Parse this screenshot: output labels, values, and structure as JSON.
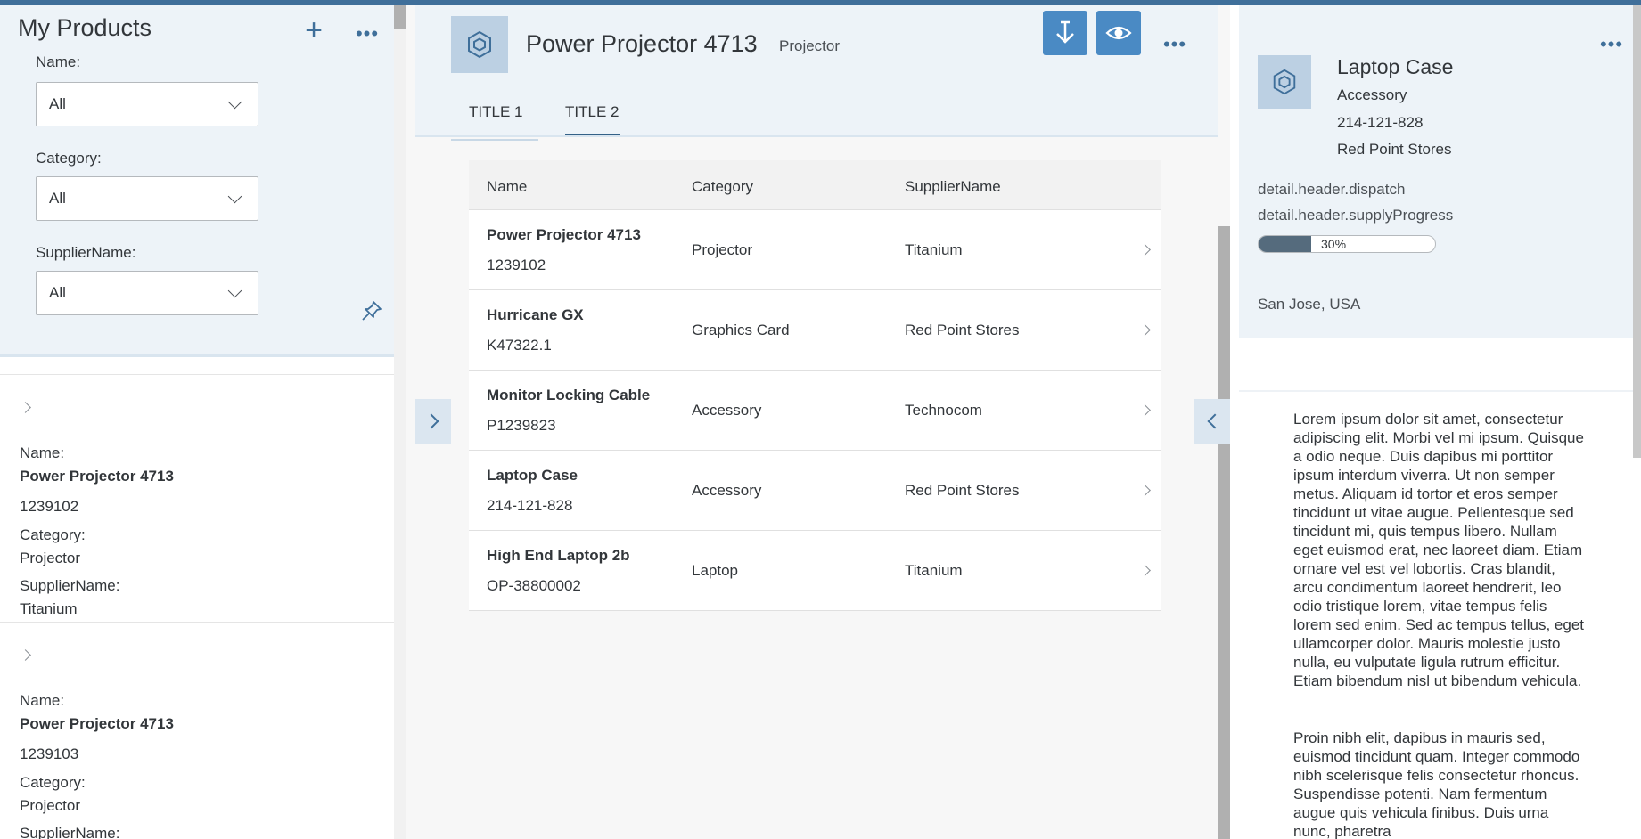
{
  "master": {
    "title": "My Products",
    "filters": [
      {
        "label": "Name:",
        "value": "All"
      },
      {
        "label": "Category:",
        "value": "All"
      },
      {
        "label": "SupplierName:",
        "value": "All"
      }
    ],
    "cards": [
      {
        "name_label": "Name:",
        "name": "Power Projector 4713",
        "id": "1239102",
        "category_label": "Category:",
        "category": "Projector",
        "supplier_label": "SupplierName:",
        "supplier": "Titanium"
      },
      {
        "name_label": "Name:",
        "name": "Power Projector 4713",
        "id": "1239103",
        "category_label": "Category:",
        "category": "Projector",
        "supplier_label": "SupplierName:"
      }
    ]
  },
  "detail": {
    "title": "Power Projector 4713",
    "subtitle": "Projector",
    "tabs": [
      {
        "label": "TITLE 1"
      },
      {
        "label": "TITLE 2"
      }
    ],
    "active_tab": "TITLE 2",
    "table": {
      "columns": [
        "Name",
        "Category",
        "SupplierName"
      ],
      "rows": [
        {
          "name": "Power Projector 4713",
          "id": "1239102",
          "category": "Projector",
          "supplier": "Titanium"
        },
        {
          "name": "Hurricane GX",
          "id": "K47322.1",
          "category": "Graphics Card",
          "supplier": "Red Point Stores"
        },
        {
          "name": "Monitor Locking Cable",
          "id": "P1239823",
          "category": "Accessory",
          "supplier": "Technocom"
        },
        {
          "name": "Laptop Case",
          "id": "214-121-828",
          "category": "Accessory",
          "supplier": "Red Point Stores"
        },
        {
          "name": "High End Laptop 2b",
          "id": "OP-38800002",
          "category": "Laptop",
          "supplier": "Titanium"
        }
      ]
    }
  },
  "side": {
    "title": "Laptop Case",
    "category": "Accessory",
    "id": "214-121-828",
    "supplier": "Red Point Stores",
    "dispatch_label": "detail.header.dispatch",
    "supply_label": "detail.header.supplyProgress",
    "progress_percent": 30,
    "progress_text": "30%",
    "location": "San Jose, USA",
    "paragraph_1": "Lorem ipsum dolor sit amet, consectetur adipiscing elit. Morbi vel mi ipsum. Quisque a odio neque. Duis dapibus mi porttitor ipsum interdum viverra. Ut non semper metus. Aliquam id tortor et eros semper tincidunt ut vitae augue. Pellentesque sed tincidunt mi, quis tempus libero. Nullam eget euismod erat, nec laoreet diam. Etiam ornare vel est vel lobortis. Cras blandit, arcu condimentum laoreet hendrerit, leo odio tristique lorem, vitae tempus felis lorem sed enim. Sed ac tempus tellus, eget ullamcorper dolor. Mauris molestie justo nulla, eu vulputate ligula rutrum efficitur. Etiam bibendum nisl ut bibendum vehicula.",
    "paragraph_2": "Proin nibh elit, dapibus in mauris sed, euismod tincidunt quam. Integer commodo nibh scelerisque felis consectetur rhoncus. Suspendisse potenti. Nam fermentum augue quis vehicula finibus. Duis urna nunc, pharetra"
  },
  "icons": {
    "add": "plus-icon",
    "more": "overflow-dots-icon",
    "pin": "pin-icon",
    "product": "product-cube-icon",
    "download": "download-icon",
    "view": "eye-icon",
    "expand": "chevron-right-icon",
    "collapse": "chevron-left-icon"
  },
  "colors": {
    "accent": "#3f6f9a",
    "button": "#4a8ac4",
    "header_bg": "#edf3f8",
    "progress_fill": "#556b7d"
  }
}
